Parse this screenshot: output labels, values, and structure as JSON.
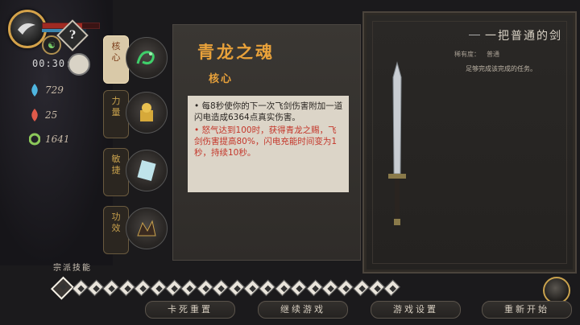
{
  "hud": {
    "timer": "00:30:51",
    "qi_icon": "question-mark-icon",
    "stats": [
      {
        "icon": "blue-flame-icon",
        "color": "#4fb6e0",
        "value": "729"
      },
      {
        "icon": "red-flame-icon",
        "color": "#e05a4a",
        "value": "25"
      },
      {
        "icon": "green-swirl-icon",
        "color": "#8cc85a",
        "value": "1641"
      }
    ]
  },
  "cards": [
    {
      "label": "核心",
      "icon": "green-dragon-icon",
      "active": true
    },
    {
      "label": "力量",
      "icon": "golden-seal-icon",
      "active": false
    },
    {
      "label": "敏捷",
      "icon": "white-scroll-icon",
      "active": false
    },
    {
      "label": "功效",
      "icon": "dark-beast-icon",
      "active": false
    }
  ],
  "detail": {
    "title": "青龙之魂",
    "subtitle": "核心",
    "desc1": "• 每8秒使你的下一次飞剑伤害附加一道闪电造成6364点真实伤害。",
    "desc2": "• 怒气达到100时，获得青龙之赐，飞剑伤害提高80%，闪电充能时间变为1秒，持续10秒。"
  },
  "weapon": {
    "name": "一把普通的剑",
    "rarity_label": "稀有度：",
    "rarity_value": "普通",
    "hint": "足够完成该完成的任务。"
  },
  "skills": {
    "label": "宗派技能",
    "count": 22
  },
  "buttons": {
    "reset": "卡死重置",
    "continue": "继续游戏",
    "settings": "游戏设置",
    "restart": "重新开始"
  },
  "colors": {
    "accent_orange": "#e8a13a",
    "desc_red": "#c4362a",
    "gold_border": "#c9a24d"
  }
}
